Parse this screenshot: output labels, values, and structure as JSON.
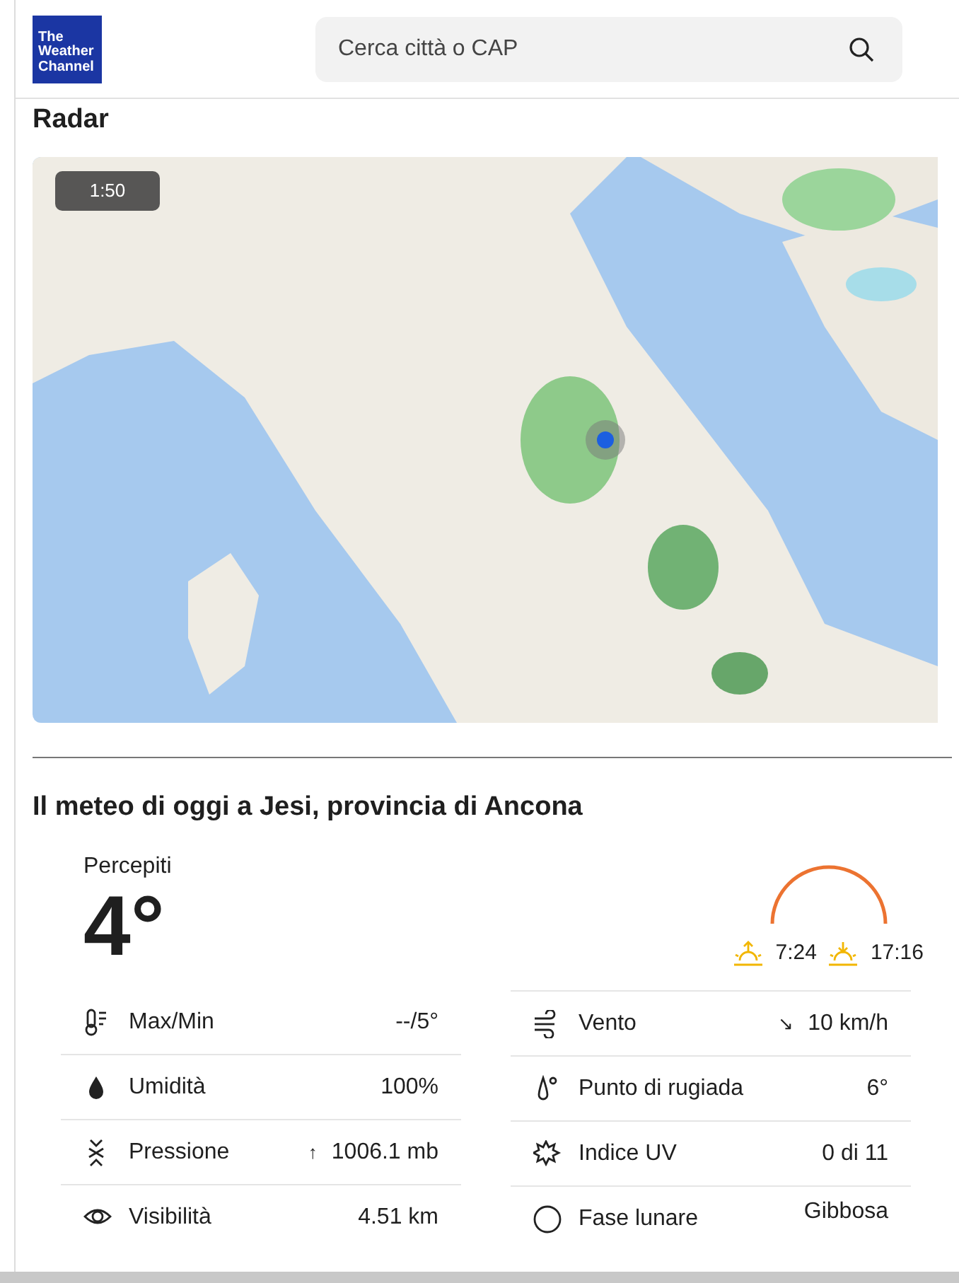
{
  "header": {
    "logo": [
      "The",
      "Weather",
      "Channel"
    ],
    "search": {
      "placeholder": "Cerca città o CAP"
    }
  },
  "radar": {
    "title": "Radar",
    "time": "1:50"
  },
  "today": {
    "title": "Il meteo di oggi a Jesi, provincia di Ancona",
    "feels_label": "Percepiti",
    "feels_value": "4°",
    "sunrise": "7:24",
    "sunset": "17:16"
  },
  "details": [
    {
      "kind": "thermometer",
      "label": "Max/Min",
      "value": "--/5°"
    },
    {
      "kind": "wind",
      "label": "Vento",
      "value": "10 km/h",
      "arrow": "↘"
    },
    {
      "kind": "drop",
      "label": "Umidità",
      "value": "100%"
    },
    {
      "kind": "dewpoint",
      "label": "Punto di rugiada",
      "value": "6°"
    },
    {
      "kind": "pressure",
      "label": "Pressione",
      "value": "1006.1 mb",
      "arrow": "↑"
    },
    {
      "kind": "uv",
      "label": "Indice UV",
      "value": "0 di 11"
    },
    {
      "kind": "eye",
      "label": "Visibilità",
      "value": "4.51 km"
    },
    {
      "kind": "moon",
      "label": "Fase lunare",
      "value": "Gibbosa"
    }
  ]
}
